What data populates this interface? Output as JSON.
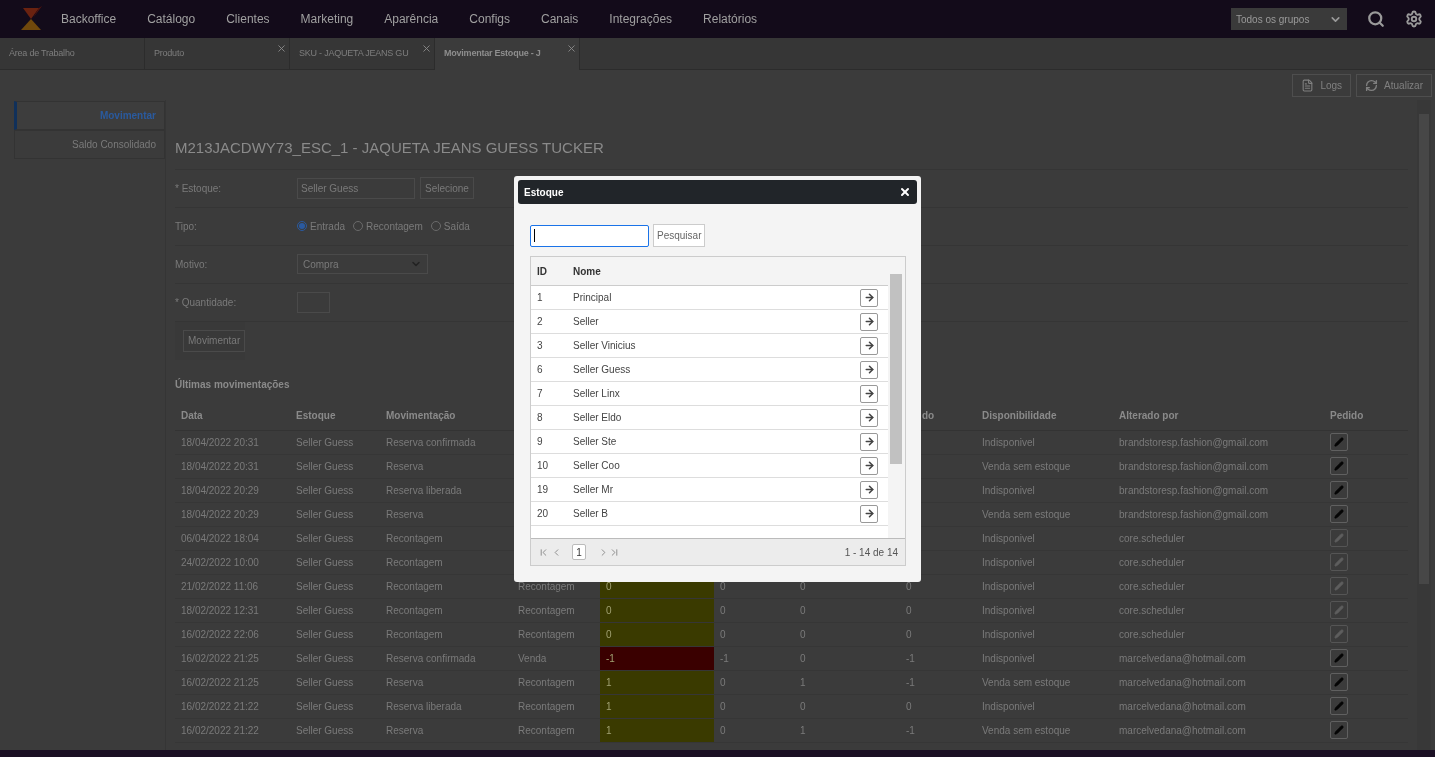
{
  "nav": {
    "items": [
      "Backoffice",
      "Catálogo",
      "Clientes",
      "Marketing",
      "Aparência",
      "Configs",
      "Canais",
      "Integrações",
      "Relatórios"
    ],
    "group_select": "Todos os grupos"
  },
  "tabs": [
    {
      "label": "Área de Trabalho",
      "closable": false,
      "selected": false
    },
    {
      "label": "Produto",
      "closable": true,
      "selected": false
    },
    {
      "label": "SKU - JAQUETA JEANS GU",
      "closable": true,
      "selected": false
    },
    {
      "label": "Movimentar Estoque - J",
      "closable": true,
      "selected": true
    }
  ],
  "toolbar": [
    {
      "label": "Logs",
      "kind": "logs"
    },
    {
      "label": "Atualizar",
      "kind": "refresh"
    }
  ],
  "sidebar": {
    "items": [
      {
        "label": "Movimentar",
        "selected": true
      },
      {
        "label": "Saldo Consolidado",
        "selected": false
      }
    ]
  },
  "product_title": "M213JACDWY73_ESC_1 - JAQUETA JEANS GUESS TUCKER",
  "form": {
    "estoque": {
      "label": "* Estoque:",
      "value": "Seller Guess",
      "button": "Selecione"
    },
    "tipo": {
      "label": "Tipo:",
      "options": [
        {
          "label": "Entrada",
          "selected": true
        },
        {
          "label": "Recontagem",
          "selected": false
        },
        {
          "label": "Saída",
          "selected": false
        }
      ]
    },
    "motivo": {
      "label": "Motivo:",
      "value": "Compra"
    },
    "quantidade": {
      "label": "* Quantidade:"
    },
    "submit": "Movimentar"
  },
  "movements": {
    "title": "Últimas movimentações",
    "header": {
      "data": "Data",
      "estoque": "Estoque",
      "movimentacao": "Movimentação",
      "column_8": "do",
      "disponibilidade": "Disponibilidade",
      "alterado_por": "Alterado por",
      "pedido": "Pedido"
    },
    "rows": [
      {
        "data": "18/04/2022 20:31",
        "estoque": "Seller Guess",
        "movimentacao": "Reserva confirmada",
        "disponibilidade": "Indisponivel",
        "alterado_por": "brandstoresp.fashion@gmail.com",
        "disabled": false
      },
      {
        "data": "18/04/2022 20:31",
        "estoque": "Seller Guess",
        "movimentacao": "Reserva",
        "disponibilidade": "Venda sem estoque",
        "alterado_por": "brandstoresp.fashion@gmail.com",
        "disabled": false
      },
      {
        "data": "18/04/2022 20:29",
        "estoque": "Seller Guess",
        "movimentacao": "Reserva liberada",
        "disponibilidade": "Indisponivel",
        "alterado_por": "brandstoresp.fashion@gmail.com",
        "disabled": false
      },
      {
        "data": "18/04/2022 20:29",
        "estoque": "Seller Guess",
        "movimentacao": "Reserva",
        "disponibilidade": "Venda sem estoque",
        "alterado_por": "brandstoresp.fashion@gmail.com",
        "disabled": false
      },
      {
        "data": "06/04/2022 18:04",
        "estoque": "Seller Guess",
        "movimentacao": "Recontagem",
        "disponibilidade": "Indisponivel",
        "alterado_por": "core.scheduler",
        "disabled": true
      },
      {
        "data": "24/02/2022 10:00",
        "estoque": "Seller Guess",
        "movimentacao": "Recontagem",
        "disponibilidade": "Indisponivel",
        "alterado_por": "core.scheduler",
        "disabled": true
      },
      {
        "data": "21/02/2022 11:06",
        "estoque": "Seller Guess",
        "movimentacao": "Recontagem",
        "column_4": "Recontagem",
        "column_5": "0",
        "color": "#3a3a00",
        "column_6": "0",
        "column_7": "0",
        "column_8": "0",
        "disponibilidade": "Indisponivel",
        "alterado_por": "core.scheduler",
        "disabled": true
      },
      {
        "data": "18/02/2022 12:31",
        "estoque": "Seller Guess",
        "movimentacao": "Recontagem",
        "column_4": "Recontagem",
        "column_5": "0",
        "color": "#3a3a00",
        "column_6": "0",
        "column_7": "0",
        "column_8": "0",
        "disponibilidade": "Indisponivel",
        "alterado_por": "core.scheduler",
        "disabled": true
      },
      {
        "data": "16/02/2022 22:06",
        "estoque": "Seller Guess",
        "movimentacao": "Recontagem",
        "column_4": "Recontagem",
        "column_5": "0",
        "color": "#3a3a00",
        "column_6": "0",
        "column_7": "0",
        "column_8": "0",
        "disponibilidade": "Indisponivel",
        "alterado_por": "core.scheduler",
        "disabled": true
      },
      {
        "data": "16/02/2022 21:25",
        "estoque": "Seller Guess",
        "movimentacao": "Reserva confirmada",
        "column_4": "Venda",
        "column_5": "-1",
        "color": "#3a0000",
        "column_6": "-1",
        "column_7": "0",
        "column_8": "-1",
        "disponibilidade": "Indisponivel",
        "alterado_por": "marcelvedana@hotmail.com",
        "disabled": false
      },
      {
        "data": "16/02/2022 21:25",
        "estoque": "Seller Guess",
        "movimentacao": "Reserva",
        "column_4": "Recontagem",
        "column_5": "1",
        "color": "#3a3a00",
        "column_6": "0",
        "column_7": "1",
        "column_8": "-1",
        "disponibilidade": "Venda sem estoque",
        "alterado_por": "marcelvedana@hotmail.com",
        "disabled": false
      },
      {
        "data": "16/02/2022 21:22",
        "estoque": "Seller Guess",
        "movimentacao": "Reserva liberada",
        "column_4": "Recontagem",
        "column_5": "1",
        "color": "#3a3a00",
        "column_6": "0",
        "column_7": "0",
        "column_8": "0",
        "disponibilidade": "Indisponivel",
        "alterado_por": "marcelvedana@hotmail.com",
        "disabled": false
      },
      {
        "data": "16/02/2022 21:22",
        "estoque": "Seller Guess",
        "movimentacao": "Reserva",
        "column_4": "Recontagem",
        "column_5": "1",
        "color": "#3a3a00",
        "column_6": "0",
        "column_7": "1",
        "column_8": "-1",
        "disponibilidade": "Venda sem estoque",
        "alterado_por": "marcelvedana@hotmail.com",
        "disabled": false
      }
    ]
  },
  "modal": {
    "title": "Estoque",
    "search_button": "Pesquisar",
    "columns": [
      "ID",
      "Nome"
    ],
    "rows": [
      {
        "id": "1",
        "name": "Principal"
      },
      {
        "id": "2",
        "name": "Seller"
      },
      {
        "id": "3",
        "name": "Seller Vinicius"
      },
      {
        "id": "6",
        "name": "Seller Guess"
      },
      {
        "id": "7",
        "name": "Seller Linx"
      },
      {
        "id": "8",
        "name": "Seller Eldo"
      },
      {
        "id": "9",
        "name": "Seller Ste"
      },
      {
        "id": "10",
        "name": "Seller Coo"
      },
      {
        "id": "19",
        "name": "Seller Mr"
      },
      {
        "id": "20",
        "name": "Seller B"
      }
    ],
    "pages": [
      {
        "label": "1",
        "selected": true
      }
    ],
    "summary": "1 - 14 de 14"
  }
}
